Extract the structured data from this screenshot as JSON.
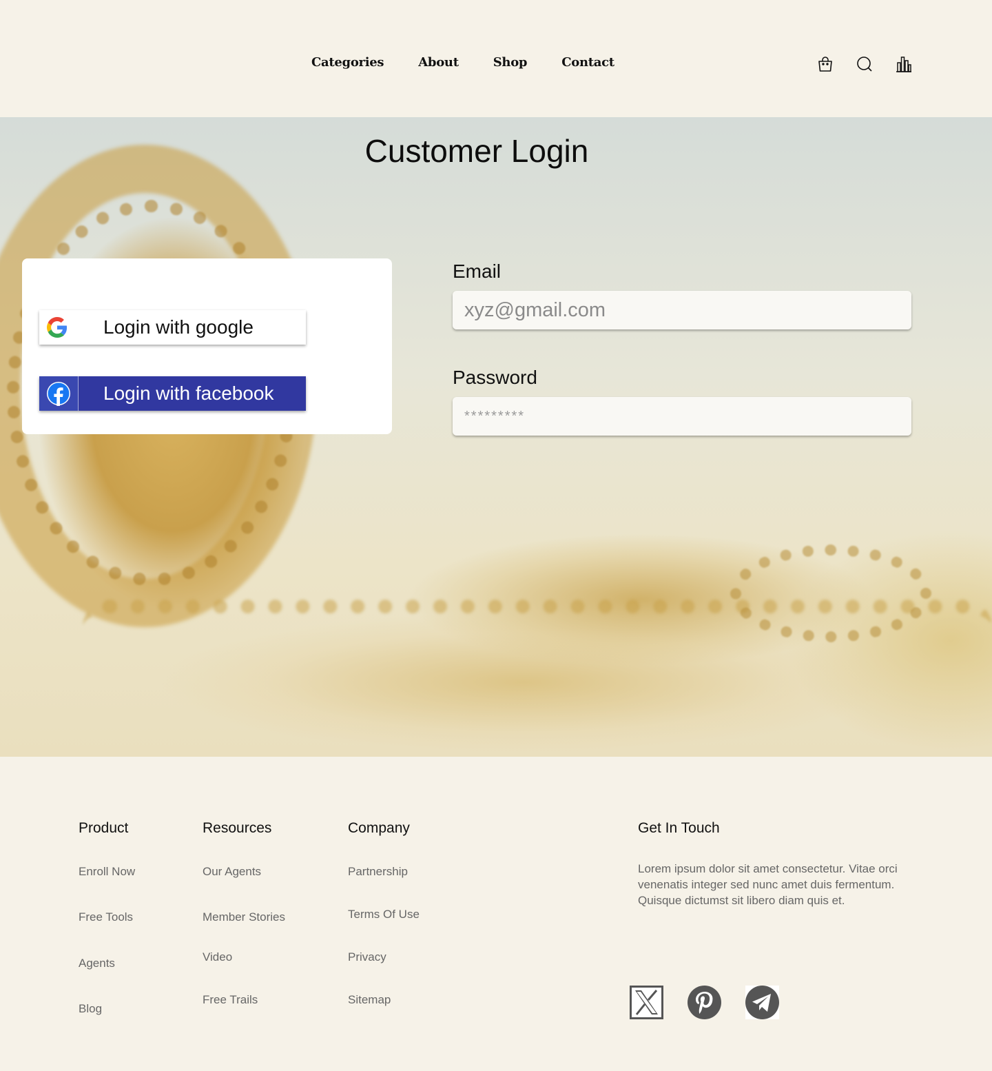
{
  "nav": {
    "items": [
      "Categories",
      "About",
      "Shop",
      "Contact"
    ]
  },
  "header_icons": [
    "shopping-bag-icon",
    "search-icon",
    "bar-chart-icon"
  ],
  "login": {
    "title": "Customer Login",
    "google_label": "Login with google",
    "facebook_label": "Login with facebook",
    "email_label": "Email",
    "email_placeholder": "xyz@gmail.com",
    "password_label": "Password",
    "password_placeholder": "*********"
  },
  "colors": {
    "page_background": "#f6f2e8",
    "facebook_blue": "#3138a0",
    "text": "#111111",
    "muted_text": "#666666"
  },
  "footer": {
    "product": {
      "heading": "Product",
      "links": [
        "Enroll Now",
        "Free Tools",
        "Agents",
        "Blog"
      ]
    },
    "resources": {
      "heading": "Resources",
      "links": [
        "Our Agents",
        "Member Stories",
        "Video",
        "Free Trails"
      ]
    },
    "company": {
      "heading": "Company",
      "links": [
        "Partnership",
        "Terms Of Use",
        "Privacy",
        "Sitemap"
      ]
    },
    "contact": {
      "heading": "Get In Touch",
      "text": "Lorem ipsum dolor sit amet consectetur. Vitae orci venenatis integer sed nunc amet duis fermentum. Quisque dictumst sit libero diam quis et."
    },
    "socials": [
      "x-icon",
      "pinterest-icon",
      "telegram-icon"
    ]
  }
}
